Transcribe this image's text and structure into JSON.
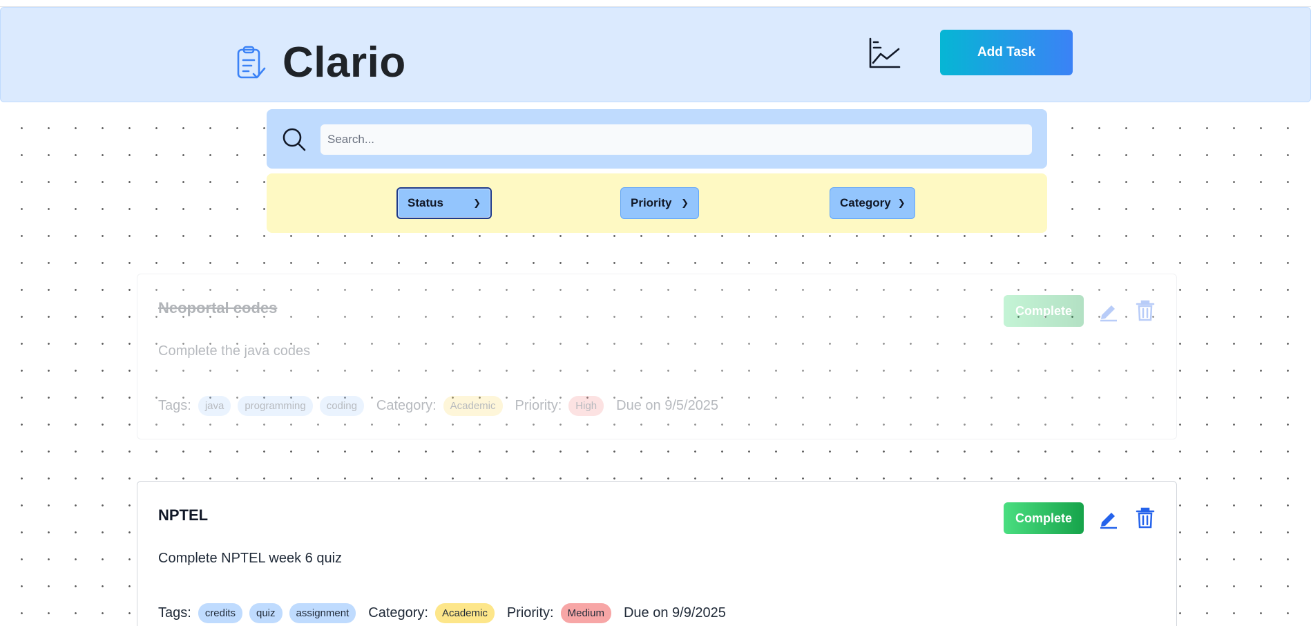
{
  "app": {
    "title": "Clario"
  },
  "header": {
    "add_task_label": "Add Task",
    "stats_icon": "chart-line-icon",
    "logo_icon": "clipboard-check-icon"
  },
  "search": {
    "placeholder": "Search...",
    "value": ""
  },
  "filters": {
    "status": "Status",
    "priority": "Priority",
    "category": "Category"
  },
  "labels": {
    "tags": "Tags:",
    "category": "Category:",
    "priority": "Priority:",
    "complete": "Complete"
  },
  "tasks": [
    {
      "title": "Neoportal codes",
      "description": "Complete the java codes",
      "tags": [
        "java",
        "programming",
        "coding"
      ],
      "category": "Academic",
      "priority": "High",
      "due": "Due on 9/5/2025",
      "completed": true
    },
    {
      "title": "NPTEL",
      "description": "Complete NPTEL week 6 quiz",
      "tags": [
        "credits",
        "quiz",
        "assignment"
      ],
      "category": "Academic",
      "priority": "Medium",
      "due": "Due on 9/9/2025",
      "completed": false
    }
  ],
  "colors": {
    "header_bg": "#dbeafe",
    "search_bg": "#bfdbfe",
    "filter_bg": "#fef9c3",
    "accent": "#3b82f6",
    "complete": "#22c55e"
  }
}
